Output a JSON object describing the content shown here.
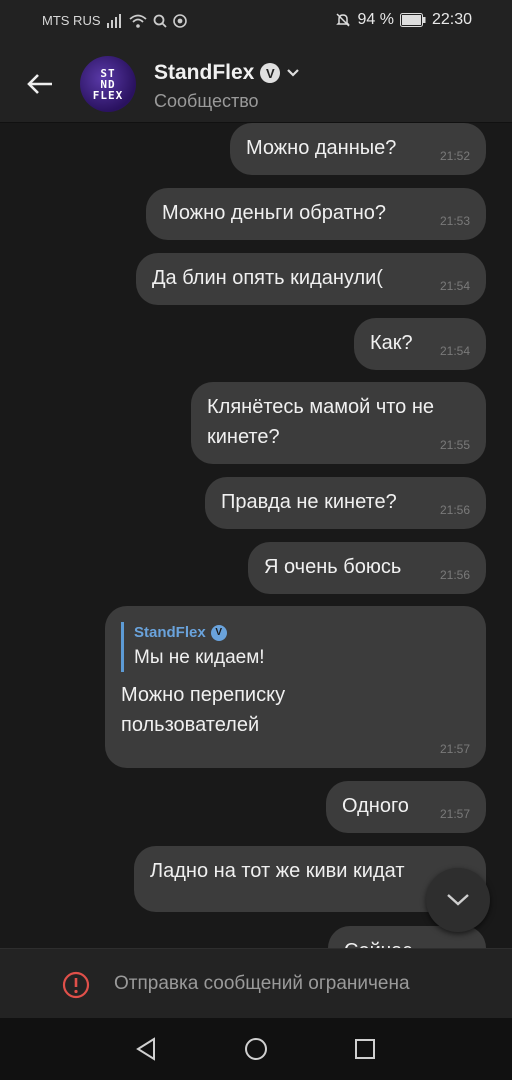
{
  "status_bar": {
    "carrier": "MTS RUS",
    "battery": "94 %",
    "time": "22:30"
  },
  "header": {
    "title": "StandFlex",
    "subtitle": "Сообщество",
    "avatar_text": [
      "ST",
      "ND",
      "FLEX"
    ]
  },
  "messages": [
    {
      "text": "Можно данные?",
      "time": "21:52"
    },
    {
      "text": "Можно деньги обратно?",
      "time": "21:53"
    },
    {
      "text": "Да блин опять киданули(",
      "time": "21:54"
    },
    {
      "text": "Как?",
      "time": "21:54"
    },
    {
      "text": "Клянётесь мамой что не кинете?",
      "time": "21:55"
    },
    {
      "text": "Правда не кинете?",
      "time": "21:56"
    },
    {
      "text": "Я очень боюсь",
      "time": "21:56"
    },
    {
      "quote_author": "StandFlex",
      "quote_text": "Мы не кидаем!",
      "text": "Можно переписку пользователей",
      "time": "21:57"
    },
    {
      "text": "Одного",
      "time": "21:57"
    },
    {
      "text": "Ладно на тот же киви кидат"
    },
    {
      "text": "Сейчас"
    }
  ],
  "restriction": {
    "text": "Отправка сообщений ограничена"
  },
  "icons": {
    "back": "back-arrow-icon",
    "chevron": "chevron-down-icon",
    "scroll_down": "scroll-down-icon",
    "warning": "warning-icon"
  },
  "colors": {
    "bubble": "#3c3c3c",
    "background": "#191919",
    "accent": "#6aa3dc",
    "warning": "#e0504a"
  }
}
